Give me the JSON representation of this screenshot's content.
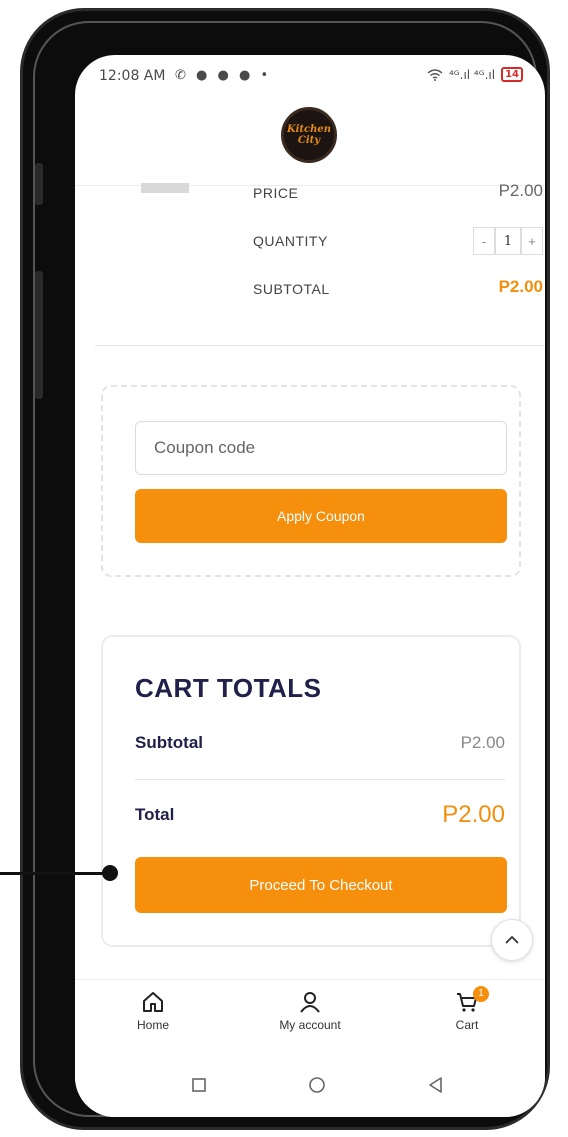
{
  "status_bar": {
    "time": "12:08 AM",
    "notifications": "✆ ● ● ● •",
    "network": "⁴ᴳ.ıl ⁴ᴳ.ıl",
    "battery": "14"
  },
  "header": {
    "logo_text": "Kitchen City"
  },
  "cart_item": {
    "price_label": "PRICE",
    "price_value": "P2.00",
    "quantity_label": "QUANTITY",
    "quantity_minus": "-",
    "quantity_value": "1",
    "quantity_plus": "+",
    "subtotal_label": "SUBTOTAL",
    "subtotal_value": "P2.00"
  },
  "coupon": {
    "placeholder": "Coupon code",
    "apply_label": "Apply Coupon"
  },
  "cart_totals": {
    "title": "CART TOTALS",
    "subtotal_label": "Subtotal",
    "subtotal_value": "P2.00",
    "total_label": "Total",
    "total_value": "P2.00",
    "checkout_label": "Proceed To Checkout"
  },
  "bottom_nav": {
    "items": [
      {
        "label": "Home",
        "icon": "home-icon"
      },
      {
        "label": "My account",
        "icon": "user-icon"
      },
      {
        "label": "Cart",
        "icon": "cart-icon",
        "badge": "1"
      }
    ]
  },
  "colors": {
    "accent": "#f58f0c",
    "heading": "#20204a"
  }
}
